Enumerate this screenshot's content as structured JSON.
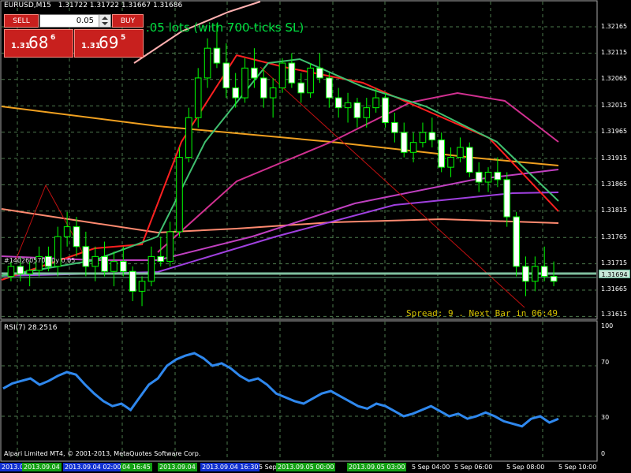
{
  "header": {
    "symbol": "EURUSD,M15",
    "ohlc": "1.31722 1.31722 1.31667 1.31686"
  },
  "trade_panel": {
    "sell_label": "SELL",
    "buy_label": "BUY",
    "lots_value": "0.05",
    "sell_price": {
      "prefix": "1.31",
      "big": "68",
      "sup": "6"
    },
    "buy_price": {
      "prefix": "1.31",
      "big": "69",
      "sup": "5"
    }
  },
  "lot_note": ".05 lots (with 700-ticks SL)",
  "order_note": "#140260570 buy 0.05",
  "spread_info": "Spread: 9 . Next Bar in 06:49",
  "rsi_label": "RSI(7) 28.2516",
  "copyright": "Alpari Limited MT4, © 2001-2013, MetaQuotes Software Corp.",
  "current_price": "1.31694",
  "price_axis": [
    "1.32165",
    "1.32115",
    "1.32065",
    "1.32015",
    "1.31965",
    "1.31915",
    "1.31865",
    "1.31815",
    "1.31765",
    "1.31715",
    "1.31665",
    "1.31615"
  ],
  "rsi_axis": [
    "100",
    "70",
    "30",
    "0"
  ],
  "time_labels": [
    {
      "text": "2013.09.04",
      "style": "blue"
    },
    {
      "text": "2013.09.04",
      "style": "green"
    },
    {
      "text": "2013.09.04 02:00",
      "style": "blue"
    },
    {
      "text": "04 16:45",
      "style": "green"
    },
    {
      "text": "2013.09.04",
      "style": "green"
    },
    {
      "text": "2013.09.04 16:30",
      "style": "blue"
    },
    {
      "text": "5 Sep",
      "style": "plain"
    },
    {
      "text": "2013.09.05 00:00",
      "style": "green"
    },
    {
      "text": "2013.09.05 03:00",
      "style": "green"
    },
    {
      "text": "5 Sep 04:00",
      "style": "plain"
    },
    {
      "text": "5 Sep 06:00",
      "style": "plain"
    },
    {
      "text": "5 Sep 08:00",
      "style": "plain"
    },
    {
      "text": "5 Sep 10:00",
      "style": "plain"
    }
  ],
  "colors": {
    "background": "#000000",
    "candle": "#00ff00",
    "grid": "#4d7a4d",
    "rsi": "#2f88ee",
    "spread": "#d6c400",
    "trade_red": "#c8201e"
  },
  "chart_data": {
    "type": "candlestick",
    "candles": [
      [
        1.317,
        1.3173,
        1.3169,
        1.3172
      ],
      [
        1.3172,
        1.3174,
        1.3169,
        1.31705
      ],
      [
        1.31705,
        1.3173,
        1.3168,
        1.31712
      ],
      [
        1.31712,
        1.3176,
        1.317,
        1.3174
      ],
      [
        1.3174,
        1.3176,
        1.3171,
        1.3172
      ],
      [
        1.3172,
        1.318,
        1.317,
        1.3178
      ],
      [
        1.3178,
        1.3183,
        1.3176,
        1.318
      ],
      [
        1.318,
        1.3182,
        1.3174,
        1.3176
      ],
      [
        1.3176,
        1.3179,
        1.317,
        1.3172
      ],
      [
        1.3172,
        1.3176,
        1.3169,
        1.3174
      ],
      [
        1.3174,
        1.3177,
        1.317,
        1.3171
      ],
      [
        1.3171,
        1.3175,
        1.3168,
        1.3173
      ],
      [
        1.3173,
        1.3176,
        1.317,
        1.3171
      ],
      [
        1.3171,
        1.3172,
        1.3165,
        1.3167
      ],
      [
        1.3167,
        1.317,
        1.3164,
        1.3169
      ],
      [
        1.3169,
        1.3176,
        1.3168,
        1.3174
      ],
      [
        1.3174,
        1.3178,
        1.3172,
        1.3173
      ],
      [
        1.3173,
        1.3181,
        1.3172,
        1.3179
      ],
      [
        1.3179,
        1.3196,
        1.3178,
        1.3194
      ],
      [
        1.3194,
        1.3204,
        1.3193,
        1.3202
      ],
      [
        1.3202,
        1.3212,
        1.32,
        1.321
      ],
      [
        1.321,
        1.3218,
        1.3208,
        1.3216
      ],
      [
        1.3216,
        1.3221,
        1.3212,
        1.3213
      ],
      [
        1.3213,
        1.3217,
        1.3206,
        1.3208
      ],
      [
        1.3208,
        1.3211,
        1.3204,
        1.3206
      ],
      [
        1.3206,
        1.3214,
        1.3205,
        1.3212
      ],
      [
        1.3212,
        1.3216,
        1.3208,
        1.321
      ],
      [
        1.321,
        1.3212,
        1.3204,
        1.3206
      ],
      [
        1.3206,
        1.321,
        1.3202,
        1.3208
      ],
      [
        1.3208,
        1.3214,
        1.3207,
        1.3213
      ],
      [
        1.3213,
        1.3215,
        1.3208,
        1.3209
      ],
      [
        1.3209,
        1.3211,
        1.3205,
        1.3207
      ],
      [
        1.3207,
        1.3213,
        1.3206,
        1.3212
      ],
      [
        1.3212,
        1.3215,
        1.3209,
        1.321
      ],
      [
        1.321,
        1.3211,
        1.3204,
        1.3206
      ],
      [
        1.3206,
        1.3208,
        1.3202,
        1.3204
      ],
      [
        1.3204,
        1.3207,
        1.3201,
        1.3205
      ],
      [
        1.3205,
        1.3206,
        1.32,
        1.3202
      ],
      [
        1.3202,
        1.3206,
        1.32,
        1.3204
      ],
      [
        1.3204,
        1.3208,
        1.3203,
        1.3206
      ],
      [
        1.3206,
        1.3207,
        1.32,
        1.3201
      ],
      [
        1.3201,
        1.3203,
        1.3197,
        1.3199
      ],
      [
        1.3199,
        1.3201,
        1.3194,
        1.3195
      ],
      [
        1.3195,
        1.3199,
        1.3193,
        1.3197
      ],
      [
        1.3197,
        1.3201,
        1.3196,
        1.3199
      ],
      [
        1.3199,
        1.3202,
        1.3196,
        1.31975
      ],
      [
        1.31975,
        1.3199,
        1.3191,
        1.3192
      ],
      [
        1.3192,
        1.3196,
        1.319,
        1.3194
      ],
      [
        1.3194,
        1.3198,
        1.3193,
        1.3196
      ],
      [
        1.3196,
        1.3197,
        1.319,
        1.3191
      ],
      [
        1.3191,
        1.3193,
        1.3187,
        1.3189
      ],
      [
        1.3189,
        1.3192,
        1.3187,
        1.3191
      ],
      [
        1.3191,
        1.3194,
        1.3188,
        1.31895
      ],
      [
        1.31895,
        1.3191,
        1.318,
        1.3182
      ],
      [
        1.3182,
        1.3183,
        1.317,
        1.3172
      ],
      [
        1.3172,
        1.3174,
        1.3166,
        1.3169
      ],
      [
        1.3169,
        1.3174,
        1.3167,
        1.3172
      ],
      [
        1.3172,
        1.3176,
        1.3169,
        1.317
      ],
      [
        1.317,
        1.3173,
        1.3168,
        1.3169
      ]
    ],
    "price_range": [
      1.31615,
      1.322
    ],
    "rsi": [
      52,
      56,
      58,
      60,
      55,
      58,
      62,
      65,
      63,
      55,
      48,
      42,
      38,
      40,
      35,
      45,
      55,
      60,
      70,
      75,
      78,
      80,
      76,
      70,
      72,
      68,
      62,
      58,
      60,
      55,
      48,
      45,
      42,
      40,
      44,
      48,
      50,
      46,
      42,
      38,
      36,
      40,
      38,
      34,
      30,
      32,
      35,
      38,
      34,
      30,
      32,
      28,
      30,
      33,
      30,
      26,
      24,
      22,
      28,
      30,
      25,
      28
    ],
    "rsi_levels": [
      30,
      70
    ],
    "rsi_range": [
      0,
      100
    ]
  }
}
